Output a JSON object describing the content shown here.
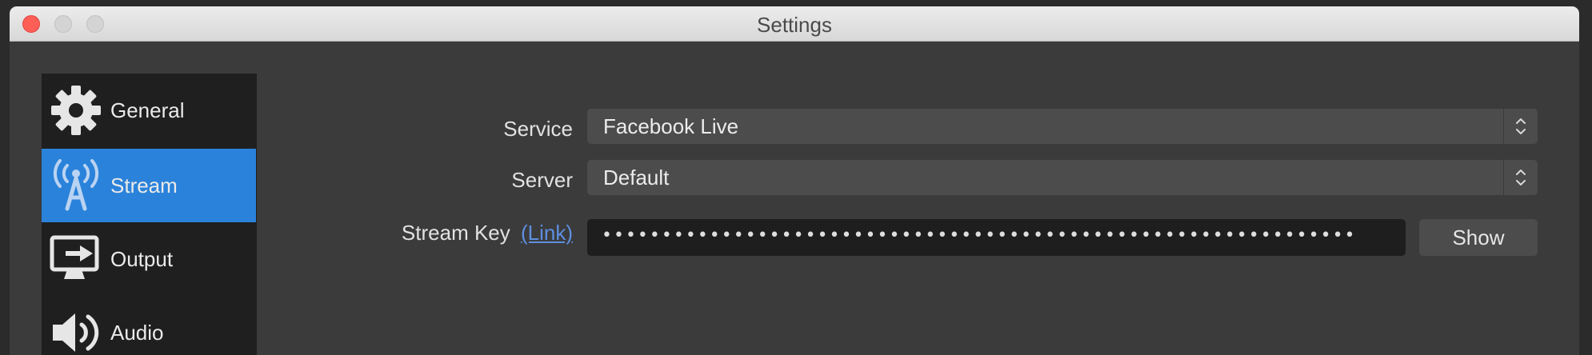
{
  "window": {
    "title": "Settings"
  },
  "sidebar": {
    "items": [
      {
        "label": "General",
        "icon": "gear-icon"
      },
      {
        "label": "Stream",
        "icon": "broadcast-tower-icon",
        "active": true
      },
      {
        "label": "Output",
        "icon": "output-monitor-icon"
      },
      {
        "label": "Audio",
        "icon": "speaker-icon"
      }
    ]
  },
  "stream": {
    "service_label": "Service",
    "service_value": "Facebook Live",
    "server_label": "Server",
    "server_value": "Default",
    "key_label": "Stream Key",
    "key_link": "(Link)",
    "key_value": "•••••••••••••••••••••••••••••••••••••••••••••••••••••••••••••••",
    "show_label": "Show"
  },
  "colors": {
    "accent": "#2a82da",
    "link": "#5e8fe0",
    "close": "#fd5f57"
  }
}
